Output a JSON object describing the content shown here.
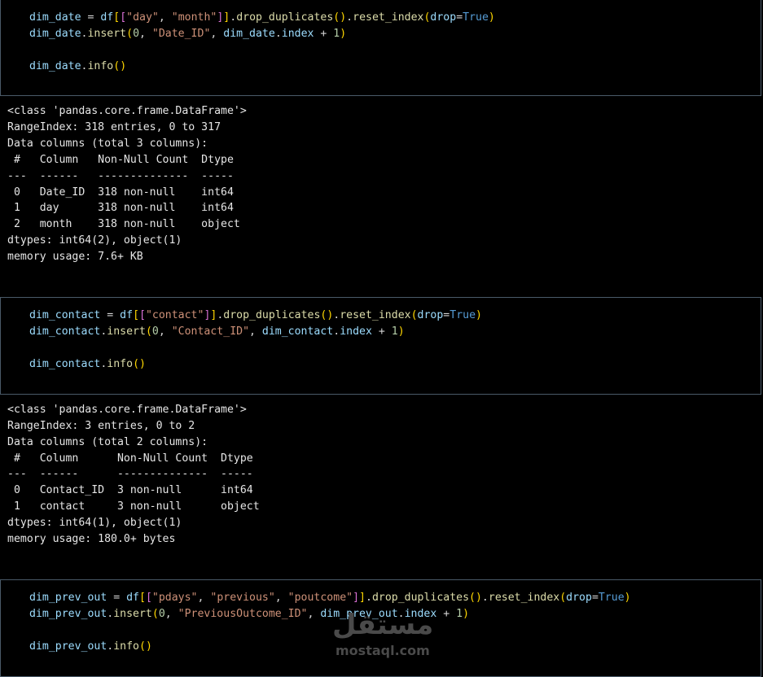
{
  "cells": [
    {
      "code": [
        "dim_date = df[[\"day\", \"month\"]].drop_duplicates().reset_index(drop=True)",
        "dim_date.insert(0, \"Date_ID\", dim_date.index + 1)",
        "",
        "dim_date.info()"
      ],
      "output": [
        "<class 'pandas.core.frame.DataFrame'>",
        "RangeIndex: 318 entries, 0 to 317",
        "Data columns (total 3 columns):",
        " #   Column   Non-Null Count  Dtype ",
        "---  ------   --------------  ----- ",
        " 0   Date_ID  318 non-null    int64 ",
        " 1   day      318 non-null    int64 ",
        " 2   month    318 non-null    object",
        "dtypes: int64(2), object(1)",
        "memory usage: 7.6+ KB"
      ]
    },
    {
      "code": [
        "dim_contact = df[[\"contact\"]].drop_duplicates().reset_index(drop=True)",
        "dim_contact.insert(0, \"Contact_ID\", dim_contact.index + 1)",
        "",
        "dim_contact.info()"
      ],
      "output": [
        "<class 'pandas.core.frame.DataFrame'>",
        "RangeIndex: 3 entries, 0 to 2",
        "Data columns (total 2 columns):",
        " #   Column      Non-Null Count  Dtype ",
        "---  ------      --------------  ----- ",
        " 0   Contact_ID  3 non-null      int64 ",
        " 1   contact     3 non-null      object",
        "dtypes: int64(1), object(1)",
        "memory usage: 180.0+ bytes"
      ]
    },
    {
      "code": [
        "dim_prev_out = df[[\"pdays\", \"previous\", \"poutcome\"]].drop_duplicates().reset_index(drop=True)",
        "dim_prev_out.insert(0, \"PreviousOutcome_ID\", dim_prev_out.index + 1)",
        "",
        "dim_prev_out.info()"
      ],
      "output": []
    }
  ],
  "watermark": {
    "arabic": "مستقل",
    "latin": "mostaql.com"
  },
  "colors": {
    "background": "#000000",
    "cell_border": "#4a5a68",
    "variable": "#9cdcfe",
    "string": "#ce9178",
    "number": "#b5cea8",
    "keyword": "#569cd6",
    "function": "#dcdcaa",
    "output_text": "#e6e6e6"
  }
}
